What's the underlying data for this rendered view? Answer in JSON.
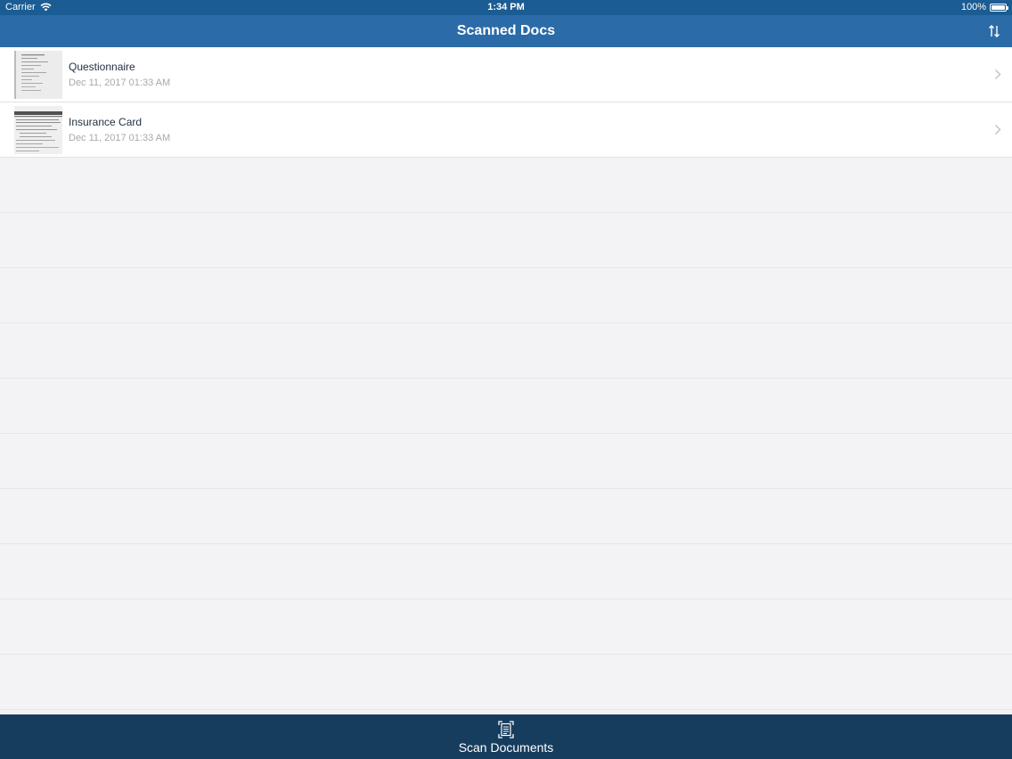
{
  "status_bar": {
    "carrier": "Carrier",
    "time": "1:34 PM",
    "battery": "100%",
    "wifi_icon": "wifi-icon",
    "battery_icon": "battery-icon"
  },
  "nav": {
    "title": "Scanned Docs",
    "sort_icon": "sort-icon",
    "color": "#2b6ba8"
  },
  "documents": [
    {
      "name": "Questionnaire",
      "date": "Dec 11, 2017 01:33 AM"
    },
    {
      "name": "Insurance Card",
      "date": "Dec 11, 2017 01:33 AM"
    }
  ],
  "tab_bar": {
    "label": "Scan Documents",
    "icon": "scan-document-icon",
    "color": "#173d5e"
  }
}
